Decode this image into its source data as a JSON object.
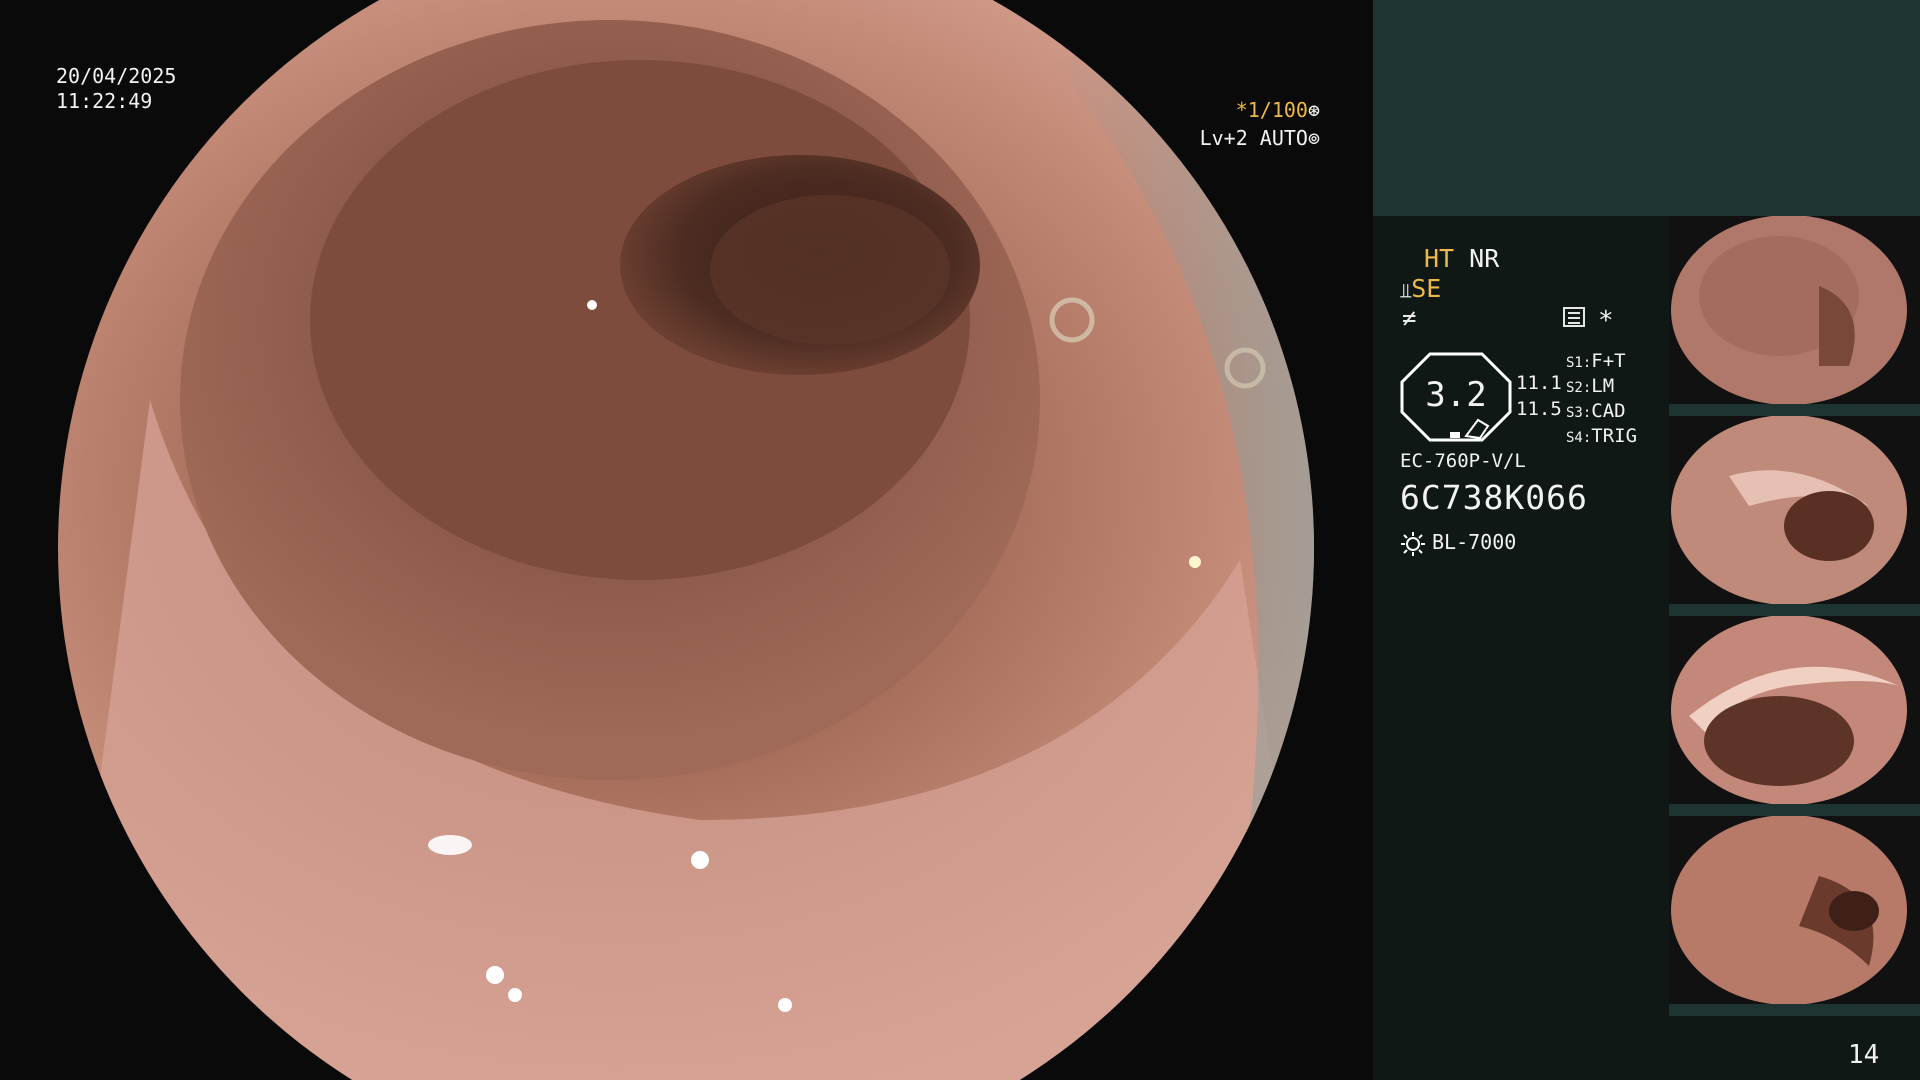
{
  "overlay": {
    "date": "20/04/2025",
    "time": "11:22:49",
    "shutter": "*1/100",
    "iris": "Lv+2 AUTO"
  },
  "panel": {
    "enhance_ht": "HT",
    "enhance_nr": "NR",
    "se_label": "SE",
    "octagon_value": "3.2",
    "value_top": "11.1",
    "value_bottom": "11.5",
    "switches": [
      {
        "key": "S1:",
        "value": "F+T"
      },
      {
        "key": "S2:",
        "value": "LM"
      },
      {
        "key": "S3:",
        "value": "CAD"
      },
      {
        "key": "S4:",
        "value": "TRIG"
      }
    ],
    "scope_model": "EC-760P-V/L",
    "scope_serial": "6C738K066",
    "light_source": "BL-7000",
    "page_number": "14"
  },
  "colors": {
    "accent": "#f0b84a",
    "panel_top": "#1d3432",
    "panel_bg": "#101816"
  },
  "thumbnails": [
    {
      "name": "thumbnail-1"
    },
    {
      "name": "thumbnail-2"
    },
    {
      "name": "thumbnail-3"
    },
    {
      "name": "thumbnail-4"
    }
  ]
}
